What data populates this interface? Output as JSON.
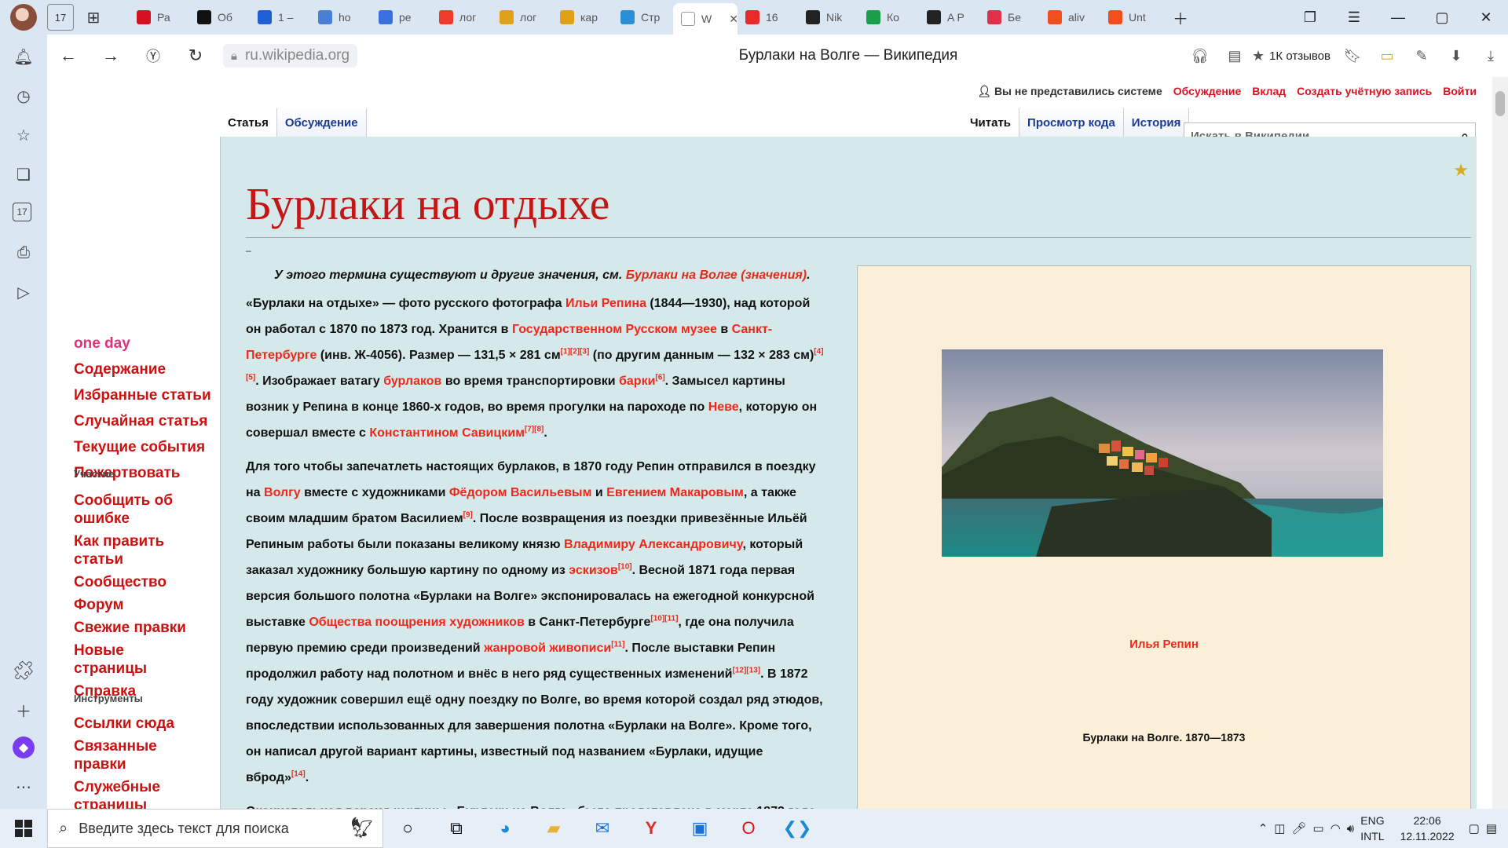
{
  "browser": {
    "tabs": [
      {
        "label": "Ра",
        "color": "#d6111f"
      },
      {
        "label": "Об",
        "color": "#111111"
      },
      {
        "label": "1 –",
        "color": "#1f5fd6"
      },
      {
        "label": "ho",
        "color": "#4a7fd6"
      },
      {
        "label": "ре",
        "color": "#3a6fe0"
      },
      {
        "label": "лог",
        "color": "#f23a2a"
      },
      {
        "label": "лог",
        "color": "#e0a11a"
      },
      {
        "label": "кар",
        "color": "#e0a11a"
      },
      {
        "label": "Стр",
        "color": "#2a8fd6"
      },
      {
        "label": "W",
        "color": "#ffffff"
      },
      {
        "label": "16",
        "color": "#e82a2a"
      },
      {
        "label": "Nik",
        "color": "#222222"
      },
      {
        "label": "Ко",
        "color": "#1a9e4a"
      },
      {
        "label": "A P",
        "color": "#222222"
      },
      {
        "label": "Бе",
        "color": "#e0314a"
      },
      {
        "label": "aliv",
        "color": "#f24e1e"
      },
      {
        "label": "Unt",
        "color": "#f24e1e"
      }
    ],
    "active_tab_index": 9,
    "url": "ru.wikipedia.org",
    "page_title": "Бурлаки на Волге — Википедия",
    "reviews": "1К отзывов"
  },
  "page": {
    "usertools": {
      "anon": "Вы не представились системе",
      "links": [
        "Обсуждение",
        "Вклад",
        "Создать учётную запись",
        "Войти"
      ]
    },
    "tabs_left": [
      "Статья",
      "Обсуждение"
    ],
    "tabs_right": [
      "Читать",
      "Просмотр кода",
      "История"
    ],
    "search_placeholder": "Искать в Википедии",
    "nav_main": [
      "one day",
      "Содержание",
      "Избранные статьи",
      "Случайная статья",
      "Текущие события",
      "Пожертвовать"
    ],
    "nav_participation_head": "Участие",
    "nav_participation": [
      "Сообщить об ошибке",
      "Как править статьи",
      "Сообщество",
      "Форум",
      "Свежие правки",
      "Новые страницы",
      "Справка"
    ],
    "nav_tools_head": "Инструменты",
    "nav_tools": [
      "Ссылки сюда",
      "Связанные правки",
      "Служебные страницы"
    ],
    "title": "Бурлаки на отдыхе",
    "dash": "–",
    "hatnote_text": "У этого термина существуют и другие значения, см. ",
    "hatnote_link": "Бурлаки на Волге (значения)",
    "infobox_author": "Илья Репин",
    "infobox_caption": "Бурлаки на Волге. 1870—1873"
  },
  "taskbar": {
    "search_placeholder": "Введите здесь текст для поиска",
    "lang_1": "ENG",
    "lang_2": "INTL",
    "time": "22:06",
    "date": "12.11.2022"
  }
}
